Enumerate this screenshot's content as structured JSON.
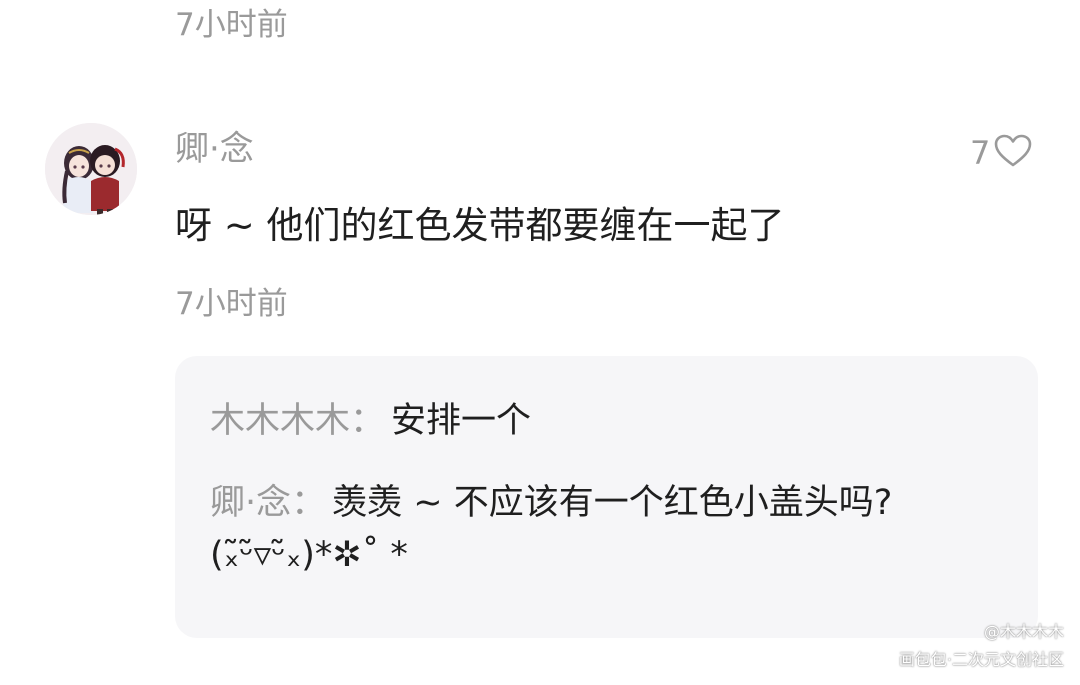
{
  "top": {
    "timestamp": "7小时前"
  },
  "comment": {
    "username": "卿·念",
    "like_count": "7",
    "text": "呀 ~ 他们的红色发带都要缠在一起了",
    "timestamp": "7小时前",
    "avatar_icon": "avatar-icon",
    "like_icon": "heart-outline-icon"
  },
  "replies": [
    {
      "author": "木木木木",
      "separator": "：",
      "text": "安排一个"
    },
    {
      "author": "卿·念",
      "separator": "：",
      "text": "羡羡 ~ 不应该有一个红色小盖头吗?",
      "text_line2": "(ₓ̃ᵕ̃▿ᵕ̃ₓ)*✲˚ *"
    }
  ],
  "watermark": {
    "line1": "@木木木木",
    "line2": "画包包·二次元文创社区"
  },
  "colors": {
    "muted": "#9a9a9a",
    "text": "#1f1f1f",
    "reply_bg": "#f6f6f8"
  }
}
